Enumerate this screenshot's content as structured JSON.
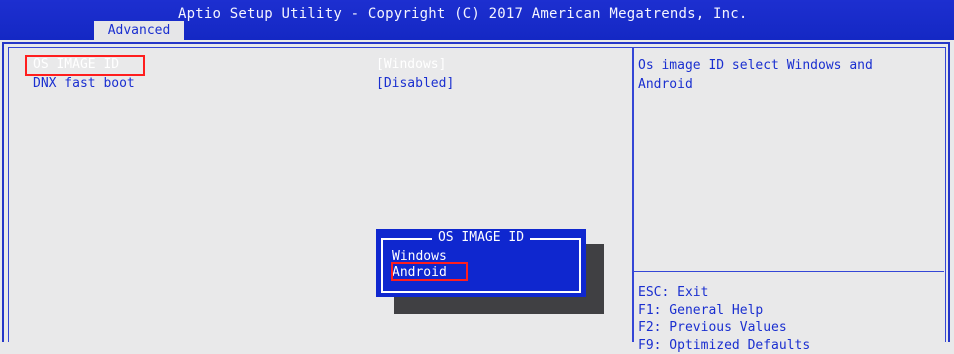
{
  "header": {
    "title": "Aptio Setup Utility - Copyright (C) 2017 American Megatrends, Inc.",
    "active_tab": "Advanced"
  },
  "settings": [
    {
      "label": "OS IMAGE ID",
      "value": "[Windows]",
      "selected": true
    },
    {
      "label": "DNX fast boot",
      "value": "[Disabled]",
      "selected": false
    }
  ],
  "help_text": "Os image ID select Windows and\nAndroid",
  "keys": [
    "ESC: Exit",
    "F1: General Help",
    "F2: Previous Values",
    "F9: Optimized Defaults"
  ],
  "popup": {
    "title": "OS IMAGE ID",
    "options": [
      "Windows",
      "Android"
    ],
    "highlighted": "Android"
  },
  "colors": {
    "header_blue": "#1428c4",
    "text_blue": "#1a2fd0",
    "background": "#e9e9ea",
    "highlight_red": "#ff1e1e"
  }
}
